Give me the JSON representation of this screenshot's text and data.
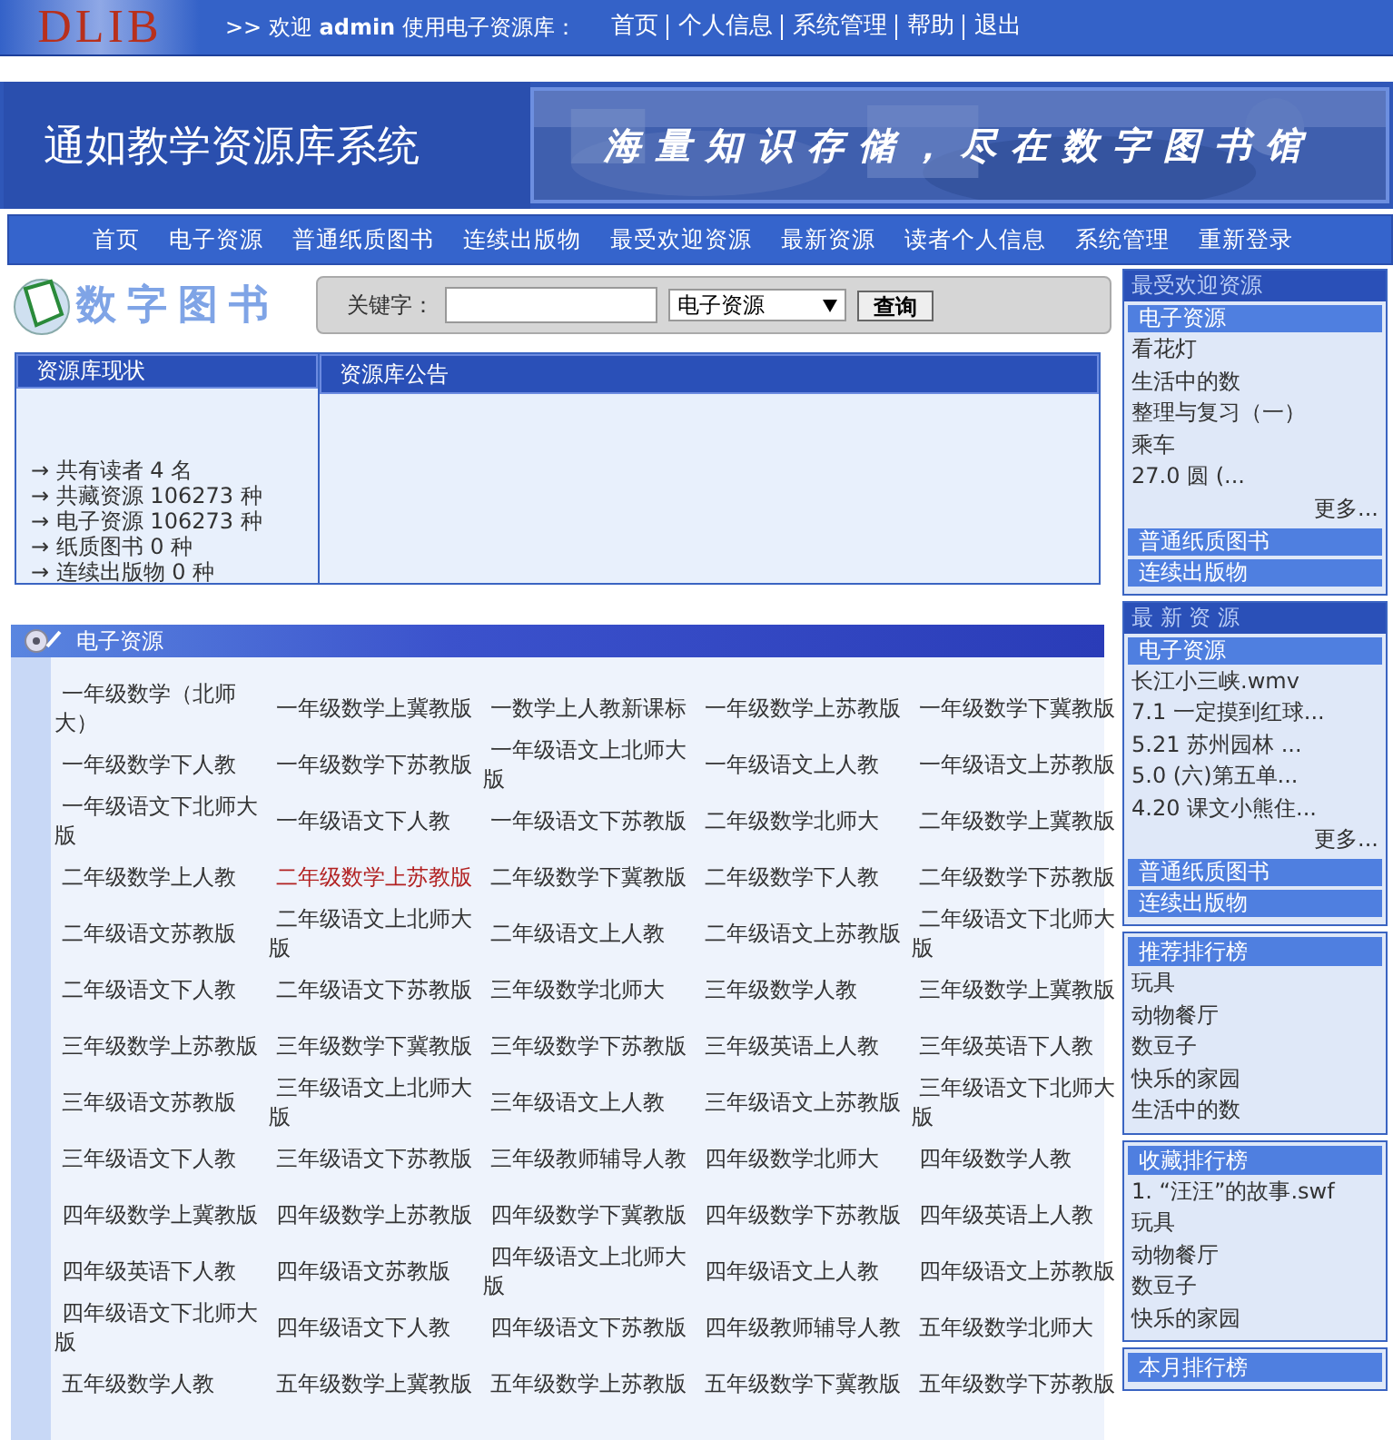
{
  "top_bar": {
    "logo": "DLIB",
    "welcome": ">> 欢迎 **admin** 使用电子资源库：",
    "links": [
      "首页",
      "个人信息",
      "系统管理",
      "帮助",
      "退出"
    ]
  },
  "header": {
    "title": "通如教学资源库系统",
    "slogan": "海量知识存储，尽在数字图书馆"
  },
  "nav": [
    "首页",
    "电子资源",
    "普通纸质图书",
    "连续出版物",
    "最受欢迎资源",
    "最新资源",
    "读者个人信息",
    "系统管理",
    "重新登录"
  ],
  "search": {
    "logo_text": "数字图书",
    "label": "关键字：",
    "category": "电子资源",
    "button": "查询"
  },
  "status": {
    "title": "资源库现状",
    "lines": [
      "→ 共有读者 4 名",
      "→ 共藏资源 106273 种",
      "→ 电子资源 106273 种",
      "→ 纸质图书 0 种",
      "→ 连续出版物 0 种"
    ]
  },
  "notice": {
    "title": "资源库公告"
  },
  "resources": {
    "title": "电子资源",
    "items": [
      {
        "label": "一年级数学（北师大）",
        "selected": false
      },
      {
        "label": "一年级数学上冀教版",
        "selected": false
      },
      {
        "label": "一数学上人教新课标",
        "selected": false
      },
      {
        "label": "一年级数学上苏教版",
        "selected": false
      },
      {
        "label": "一年级数学下冀教版",
        "selected": false
      },
      {
        "label": "一年级数学下人教",
        "selected": false
      },
      {
        "label": "一年级数学下苏教版",
        "selected": false
      },
      {
        "label": "一年级语文上北师大版",
        "selected": false
      },
      {
        "label": "一年级语文上人教",
        "selected": false
      },
      {
        "label": "一年级语文上苏教版",
        "selected": false
      },
      {
        "label": "一年级语文下北师大版",
        "selected": false
      },
      {
        "label": "一年级语文下人教",
        "selected": false
      },
      {
        "label": "一年级语文下苏教版",
        "selected": false
      },
      {
        "label": "二年级数学北师大",
        "selected": false
      },
      {
        "label": "二年级数学上冀教版",
        "selected": false
      },
      {
        "label": "二年级数学上人教",
        "selected": false
      },
      {
        "label": "二年级数学上苏教版",
        "selected": true
      },
      {
        "label": "二年级数学下冀教版",
        "selected": false
      },
      {
        "label": "二年级数学下人教",
        "selected": false
      },
      {
        "label": "二年级数学下苏教版",
        "selected": false
      },
      {
        "label": "二年级语文苏教版",
        "selected": false
      },
      {
        "label": "二年级语文上北师大版",
        "selected": false
      },
      {
        "label": "二年级语文上人教",
        "selected": false
      },
      {
        "label": "二年级语文上苏教版",
        "selected": false
      },
      {
        "label": "二年级语文下北师大版",
        "selected": false
      },
      {
        "label": "二年级语文下人教",
        "selected": false
      },
      {
        "label": "二年级语文下苏教版",
        "selected": false
      },
      {
        "label": "三年级数学北师大",
        "selected": false
      },
      {
        "label": "三年级数学人教",
        "selected": false
      },
      {
        "label": "三年级数学上冀教版",
        "selected": false
      },
      {
        "label": "三年级数学上苏教版",
        "selected": false
      },
      {
        "label": "三年级数学下冀教版",
        "selected": false
      },
      {
        "label": "三年级数学下苏教版",
        "selected": false
      },
      {
        "label": "三年级英语上人教",
        "selected": false
      },
      {
        "label": "三年级英语下人教",
        "selected": false
      },
      {
        "label": "三年级语文苏教版",
        "selected": false
      },
      {
        "label": "三年级语文上北师大版",
        "selected": false
      },
      {
        "label": "三年级语文上人教",
        "selected": false
      },
      {
        "label": "三年级语文上苏教版",
        "selected": false
      },
      {
        "label": "三年级语文下北师大版",
        "selected": false
      },
      {
        "label": "三年级语文下人教",
        "selected": false
      },
      {
        "label": "三年级语文下苏教版",
        "selected": false
      },
      {
        "label": "三年级教师辅导人教",
        "selected": false
      },
      {
        "label": "四年级数学北师大",
        "selected": false
      },
      {
        "label": "四年级数学人教",
        "selected": false
      },
      {
        "label": "四年级数学上冀教版",
        "selected": false
      },
      {
        "label": "四年级数学上苏教版",
        "selected": false
      },
      {
        "label": "四年级数学下冀教版",
        "selected": false
      },
      {
        "label": "四年级数学下苏教版",
        "selected": false
      },
      {
        "label": "四年级英语上人教",
        "selected": false
      },
      {
        "label": "四年级英语下人教",
        "selected": false
      },
      {
        "label": "四年级语文苏教版",
        "selected": false
      },
      {
        "label": "四年级语文上北师大版",
        "selected": false
      },
      {
        "label": "四年级语文上人教",
        "selected": false
      },
      {
        "label": "四年级语文上苏教版",
        "selected": false
      },
      {
        "label": "四年级语文下北师大版",
        "selected": false
      },
      {
        "label": "四年级语文下人教",
        "selected": false
      },
      {
        "label": "四年级语文下苏教版",
        "selected": false
      },
      {
        "label": "四年级教师辅导人教",
        "selected": false
      },
      {
        "label": "五年级数学北师大",
        "selected": false
      },
      {
        "label": "五年级数学人教",
        "selected": false
      },
      {
        "label": "五年级数学上冀教版",
        "selected": false
      },
      {
        "label": "五年级数学上苏教版",
        "selected": false
      },
      {
        "label": "五年级数学下冀教版",
        "selected": false
      },
      {
        "label": "五年级数学下苏教版",
        "selected": false
      }
    ]
  },
  "sidebar": [
    {
      "title": "最受欢迎资源",
      "kind": "dark",
      "items": [
        {
          "kind": "subheader",
          "label": "电子资源"
        },
        {
          "kind": "item",
          "label": "看花灯"
        },
        {
          "kind": "item",
          "label": "生活中的数"
        },
        {
          "kind": "item",
          "label": "整理与复习（一）"
        },
        {
          "kind": "item",
          "label": "乘车"
        },
        {
          "kind": "item",
          "label": "27.0 圆 (..."
        },
        {
          "kind": "more",
          "label": "更多..."
        },
        {
          "kind": "subheader",
          "label": "普通纸质图书"
        },
        {
          "kind": "subheader",
          "label": "连续出版物"
        }
      ]
    },
    {
      "title": "最 新 资 源",
      "kind": "dark",
      "items": [
        {
          "kind": "subheader",
          "label": "电子资源"
        },
        {
          "kind": "item",
          "label": "长江小三峡.wmv"
        },
        {
          "kind": "item",
          "label": "7.1 一定摸到红球..."
        },
        {
          "kind": "item",
          "label": "5.21 苏州园林 ..."
        },
        {
          "kind": "item",
          "label": "5.0 (六)第五单..."
        },
        {
          "kind": "item",
          "label": "4.20 课文小熊住..."
        },
        {
          "kind": "more",
          "label": "更多..."
        },
        {
          "kind": "subheader",
          "label": "普通纸质图书"
        },
        {
          "kind": "subheader",
          "label": "连续出版物"
        }
      ]
    },
    {
      "title": "推荐排行榜",
      "kind": "bright",
      "items": [
        {
          "kind": "item",
          "label": "玩具"
        },
        {
          "kind": "item",
          "label": "动物餐厅"
        },
        {
          "kind": "item",
          "label": "数豆子"
        },
        {
          "kind": "item",
          "label": "快乐的家园"
        },
        {
          "kind": "item",
          "label": "生活中的数"
        }
      ]
    },
    {
      "title": "收藏排行榜",
      "kind": "bright",
      "items": [
        {
          "kind": "item",
          "label": "1. “汪汪”的故事.swf"
        },
        {
          "kind": "item",
          "label": "玩具"
        },
        {
          "kind": "item",
          "label": "动物餐厅"
        },
        {
          "kind": "item",
          "label": "数豆子"
        },
        {
          "kind": "item",
          "label": "快乐的家园"
        }
      ]
    },
    {
      "title": "本月排行榜",
      "kind": "bright"
    }
  ]
}
